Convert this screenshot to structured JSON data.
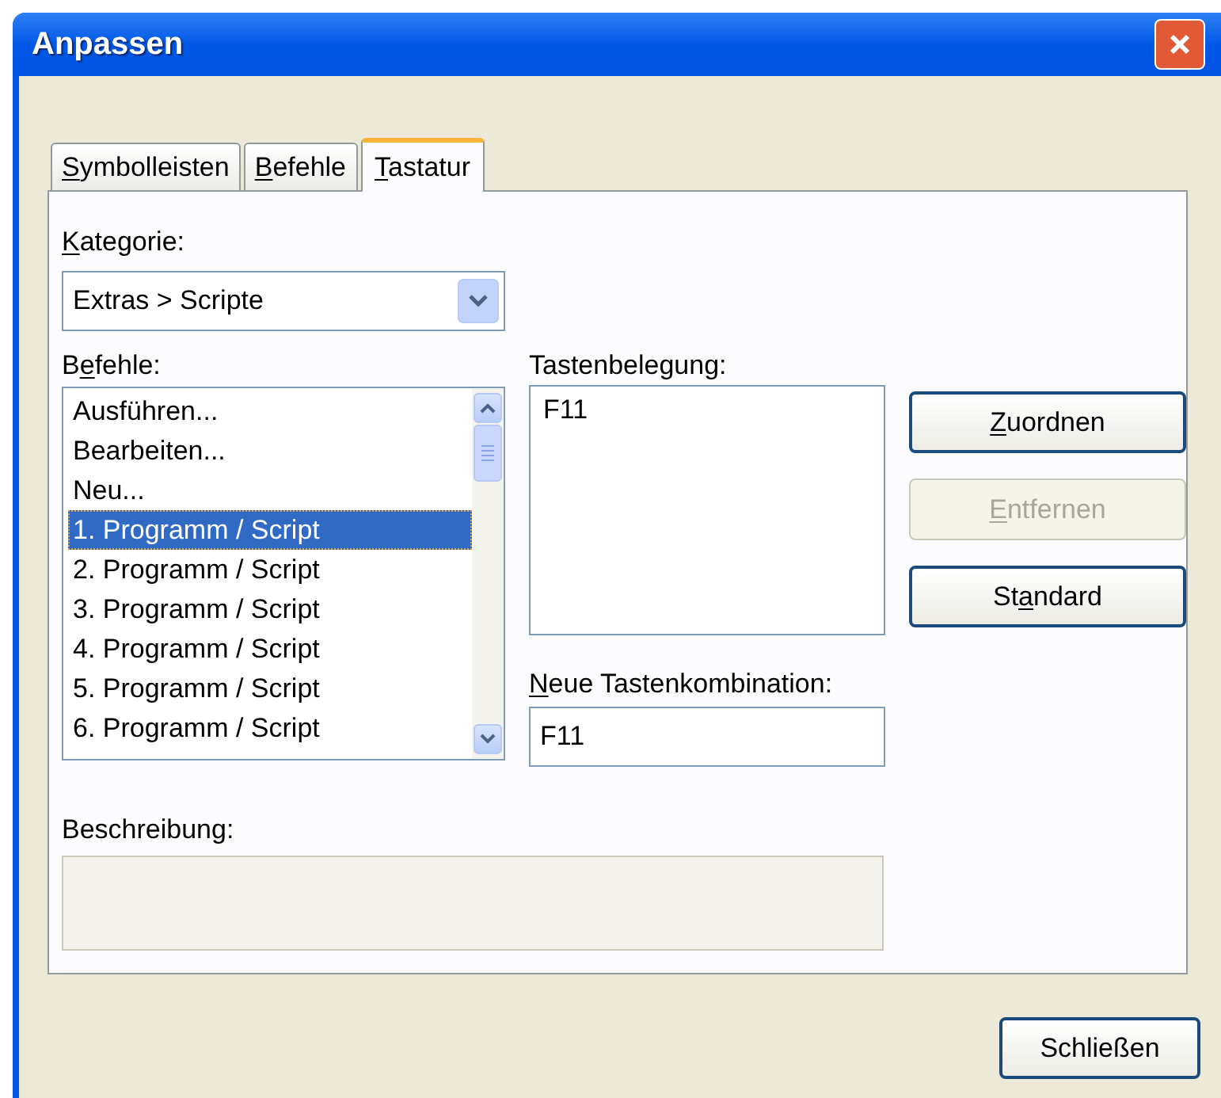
{
  "window": {
    "title": "Anpassen"
  },
  "tabs": [
    {
      "access_key": "S",
      "label_after": "ymbolleisten",
      "selected": false
    },
    {
      "access_key": "B",
      "label_after": "efehle",
      "selected": false
    },
    {
      "access_key": "T",
      "label_after": "astatur",
      "selected": true
    }
  ],
  "category": {
    "access_key": "K",
    "label_after": "ategorie:",
    "value": "Extras > Scripte"
  },
  "commands": {
    "label_before": "B",
    "access_key": "e",
    "label_after": "fehle:",
    "items": [
      {
        "label": "Ausführen...",
        "selected": false
      },
      {
        "label": "Bearbeiten...",
        "selected": false
      },
      {
        "label": "Neu...",
        "selected": false
      },
      {
        "label": "1. Programm / Script",
        "selected": true
      },
      {
        "label": "2. Programm / Script",
        "selected": false
      },
      {
        "label": "3. Programm / Script",
        "selected": false
      },
      {
        "label": "4. Programm / Script",
        "selected": false
      },
      {
        "label": "5. Programm / Script",
        "selected": false
      },
      {
        "label": "6. Programm / Script",
        "selected": false
      }
    ]
  },
  "assigned_keys": {
    "label_before": "Tastenbelegung:",
    "items": [
      "F11"
    ]
  },
  "buttons": [
    {
      "access_key": "Z",
      "label_after": "uordnen",
      "disabled": false
    },
    {
      "access_key": "E",
      "label_after": "ntfernen",
      "disabled": true
    },
    {
      "label_before": "St",
      "access_key": "a",
      "label_after": "ndard",
      "disabled": false
    }
  ],
  "new_shortcut": {
    "access_key": "N",
    "label_after": "eue Tastenkombination:",
    "value": "F11"
  },
  "description": {
    "label_before": "Beschreibung:"
  },
  "close_button": {
    "label": "Schließen"
  }
}
